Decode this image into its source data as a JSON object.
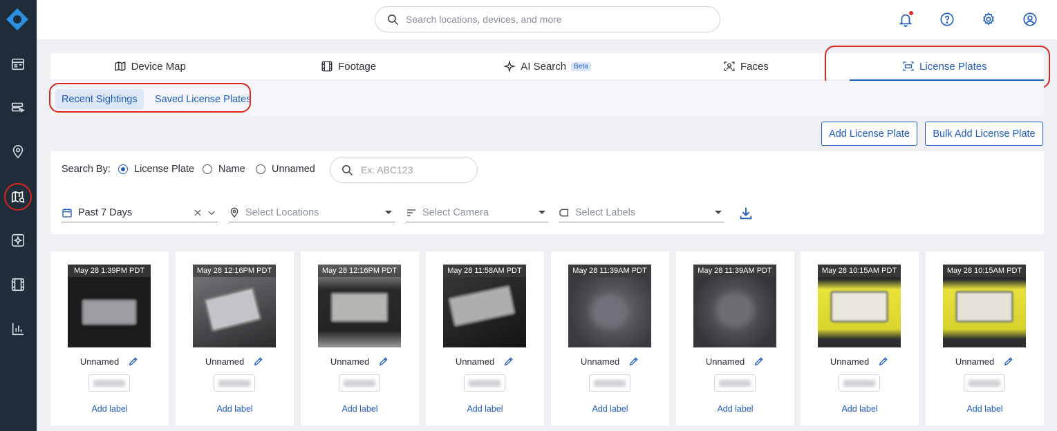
{
  "search": {
    "placeholder": "Search locations, devices, and more"
  },
  "tabs": [
    {
      "label": "Device Map",
      "icon": "map-icon"
    },
    {
      "label": "Footage",
      "icon": "film-icon"
    },
    {
      "label": "AI Search",
      "icon": "sparkle-icon",
      "badge": "Beta"
    },
    {
      "label": "Faces",
      "icon": "face-scan-icon"
    },
    {
      "label": "License Plates",
      "icon": "license-plate-icon",
      "active": true
    }
  ],
  "subtabs": [
    {
      "label": "Recent Sightings",
      "active": true
    },
    {
      "label": "Saved License Plates"
    }
  ],
  "actions": {
    "add_plate": "Add License Plate",
    "bulk_add": "Bulk Add License Plate"
  },
  "filters": {
    "search_by_label": "Search By:",
    "options": [
      "License Plate",
      "Name",
      "Unnamed"
    ],
    "selected_option": "License Plate",
    "plate_placeholder": "Ex: ABC123",
    "date_range": "Past 7 Days",
    "locations_placeholder": "Select Locations",
    "camera_placeholder": "Select Camera",
    "labels_placeholder": "Select Labels"
  },
  "cards": [
    {
      "timestamp": "May 28 1:39PM PDT",
      "name": "Unnamed",
      "add_label": "Add label"
    },
    {
      "timestamp": "May 28 12:16PM PDT",
      "name": "Unnamed",
      "add_label": "Add label"
    },
    {
      "timestamp": "May 28 12:16PM PDT",
      "name": "Unnamed",
      "add_label": "Add label"
    },
    {
      "timestamp": "May 28 11:58AM PDT",
      "name": "Unnamed",
      "add_label": "Add label"
    },
    {
      "timestamp": "May 28 11:39AM PDT",
      "name": "Unnamed",
      "add_label": "Add label"
    },
    {
      "timestamp": "May 28 11:39AM PDT",
      "name": "Unnamed",
      "add_label": "Add label"
    },
    {
      "timestamp": "May 28 10:15AM PDT",
      "name": "Unnamed",
      "add_label": "Add label"
    },
    {
      "timestamp": "May 28 10:15AM PDT",
      "name": "Unnamed",
      "add_label": "Add label"
    }
  ],
  "colors": {
    "accent": "#1e5bbf",
    "sidebar": "#1f2d3a",
    "highlight": "#d9271d"
  }
}
